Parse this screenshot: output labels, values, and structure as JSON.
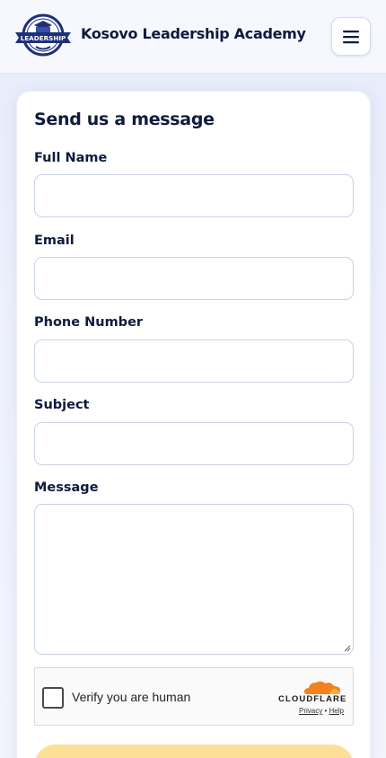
{
  "header": {
    "brand_name": "Kosovo Leadership Academy",
    "logo": {
      "banner_text": "LEADERSHIP",
      "top_text": "KOSOVO",
      "bottom_text": "ACADEMY",
      "colors": {
        "primary": "#1f2f7a",
        "accent": "#ffffff"
      }
    },
    "menu_icon": "hamburger-icon"
  },
  "form": {
    "title": "Send us a message",
    "fields": {
      "full_name": {
        "label": "Full Name",
        "value": ""
      },
      "email": {
        "label": "Email",
        "value": ""
      },
      "phone": {
        "label": "Phone Number",
        "value": ""
      },
      "subject": {
        "label": "Subject",
        "value": ""
      },
      "message": {
        "label": "Message",
        "value": ""
      }
    },
    "captcha": {
      "label": "Verify you are human",
      "provider": "CLOUDFLARE",
      "privacy_link": "Privacy",
      "separator": "•",
      "help_link": "Help",
      "checked": false
    },
    "submit_color": "#fde095"
  },
  "colors": {
    "text": "#0f1a3d",
    "border": "#c9d2e6",
    "background": "#eef1fc",
    "cloudflare_orange": "#f48120"
  }
}
